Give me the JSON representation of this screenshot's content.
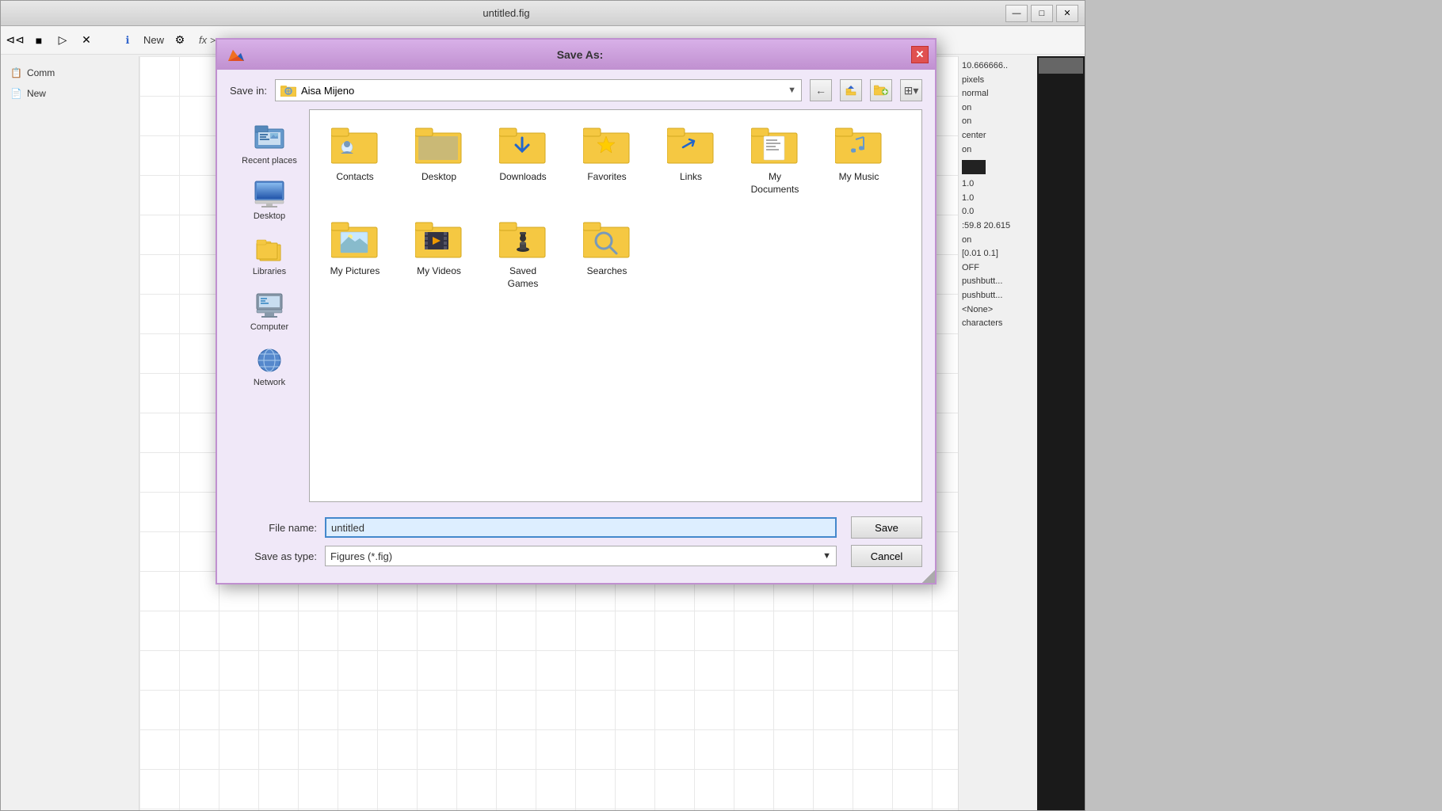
{
  "bg_window": {
    "title": "untitled.fig",
    "controls": {
      "minimize": "—",
      "maximize": "□",
      "close": "✕"
    },
    "toolbar": {
      "back_arrow": "◄◄",
      "stop": "■",
      "forward": "►",
      "close_btn": "✕"
    },
    "left_nav": {
      "label_comm": "Comm",
      "label_new": "New",
      "icon_fx": "fx",
      "icon_arrows": ">>"
    },
    "right_panel_values": [
      "10.666666..",
      "pixels",
      "normal",
      "on",
      "on",
      "center",
      "on",
      "",
      "1.0",
      "1.0",
      "0.0",
      ":59.8 20.615",
      "on",
      "[0.01 0.1]",
      "OFF",
      "pushbutt...",
      "pushbutt...",
      "",
      "<None>",
      "characters"
    ]
  },
  "dialog": {
    "title": "Save As:",
    "close_btn": "✕",
    "save_in_label": "Save in:",
    "save_in_value": "Aisa Mijeno",
    "nav_back": "←",
    "nav_up": "↑",
    "nav_new_folder": "📁",
    "nav_views": "⊞",
    "left_sidebar": [
      {
        "id": "recent",
        "label": "Recent places"
      },
      {
        "id": "desktop",
        "label": "Desktop"
      },
      {
        "id": "libraries",
        "label": "Libraries"
      },
      {
        "id": "computer",
        "label": "Computer"
      },
      {
        "id": "network",
        "label": "Network"
      }
    ],
    "folders": [
      {
        "id": "contacts",
        "label": "Contacts"
      },
      {
        "id": "desktop",
        "label": "Desktop"
      },
      {
        "id": "downloads",
        "label": "Downloads"
      },
      {
        "id": "favorites",
        "label": "Favorites"
      },
      {
        "id": "links",
        "label": "Links"
      },
      {
        "id": "my_documents",
        "label": "My Documents"
      },
      {
        "id": "my_music",
        "label": "My Music"
      },
      {
        "id": "my_pictures",
        "label": "My Pictures"
      },
      {
        "id": "my_videos",
        "label": "My Videos"
      },
      {
        "id": "saved_games",
        "label": "Saved Games"
      },
      {
        "id": "searches",
        "label": "Searches"
      }
    ],
    "file_name_label": "File name:",
    "file_name_value": "untitled",
    "file_name_placeholder": "untitled",
    "save_type_label": "Save as type:",
    "save_type_value": "Figures (*.fig)",
    "save_btn": "Save",
    "cancel_btn": "Cancel"
  }
}
